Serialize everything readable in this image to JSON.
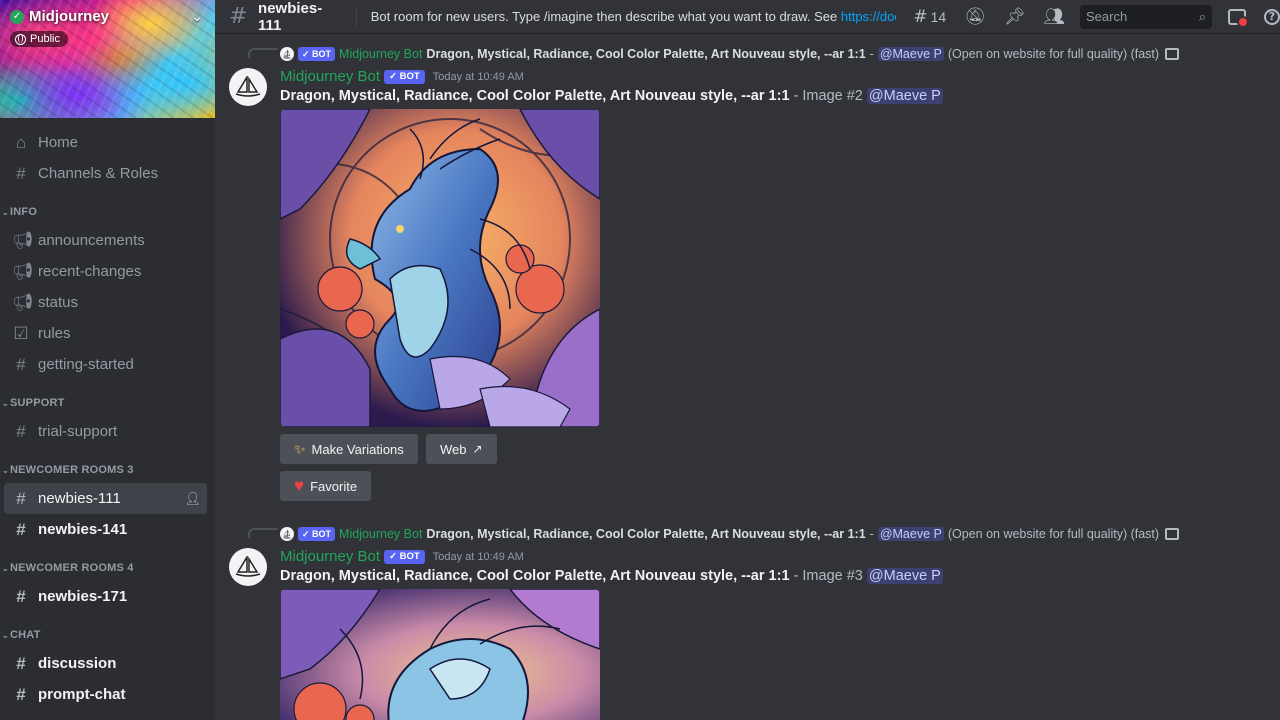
{
  "server": {
    "name": "Midjourney",
    "badge": "Public"
  },
  "nav": {
    "top": [
      {
        "label": "Home",
        "icon": "home-icon"
      },
      {
        "label": "Channels & Roles",
        "icon": "channels-roles-icon"
      }
    ],
    "categories": [
      {
        "name": "INFO",
        "channels": [
          "announcements",
          "recent-changes",
          "status",
          "rules",
          "getting-started"
        ]
      },
      {
        "name": "SUPPORT",
        "channels": [
          "trial-support"
        ]
      },
      {
        "name": "NEWCOMER ROOMS 3",
        "channels": [
          "newbies-111",
          "newbies-141"
        ]
      },
      {
        "name": "NEWCOMER ROOMS 4",
        "channels": [
          "newbies-171"
        ]
      },
      {
        "name": "CHAT",
        "channels": [
          "discussion",
          "prompt-chat"
        ]
      }
    ]
  },
  "topbar": {
    "channel": "newbies-111",
    "topic_text": "Bot room for new users. Type /imagine then describe what you want to draw. See ",
    "topic_link": "https://docs.midj...",
    "threads_count": "14",
    "search_placeholder": "Search"
  },
  "messages": [
    {
      "reply_author": "Midjourney Bot",
      "reply_bot_tag": "✓ BOT",
      "reply_prompt": "Dragon, Mystical, Radiance, Cool Color Palette, Art Nouveau style, --ar 1:1",
      "reply_sep": "-",
      "reply_mention": "@Maeve P",
      "reply_note": "(Open on website for full quality) (fast)",
      "author": "Midjourney Bot",
      "bot_tag": "✓ BOT",
      "timestamp": "Today at 10:49 AM",
      "prompt": "Dragon, Mystical, Radiance, Cool Color Palette, Art Nouveau style, --ar 1:1",
      "suffix": " - Image #2 ",
      "mention": "@Maeve P",
      "buttons": {
        "variations": "Make Variations",
        "web": "Web",
        "favorite": "Favorite"
      }
    },
    {
      "reply_author": "Midjourney Bot",
      "reply_bot_tag": "✓ BOT",
      "reply_prompt": "Dragon, Mystical, Radiance, Cool Color Palette, Art Nouveau style, --ar 1:1",
      "reply_sep": "-",
      "reply_mention": "@Maeve P",
      "reply_note": "(Open on website for full quality) (fast)",
      "author": "Midjourney Bot",
      "bot_tag": "✓ BOT",
      "timestamp": "Today at 10:49 AM",
      "prompt": "Dragon, Mystical, Radiance, Cool Color Palette, Art Nouveau style, --ar 1:1",
      "suffix": " - Image #3 ",
      "mention": "@Maeve P"
    }
  ],
  "colors": {
    "accent": "#5865f2",
    "bot_name": "#23a55a",
    "link": "#00a8fc",
    "alert": "#f23f42"
  }
}
